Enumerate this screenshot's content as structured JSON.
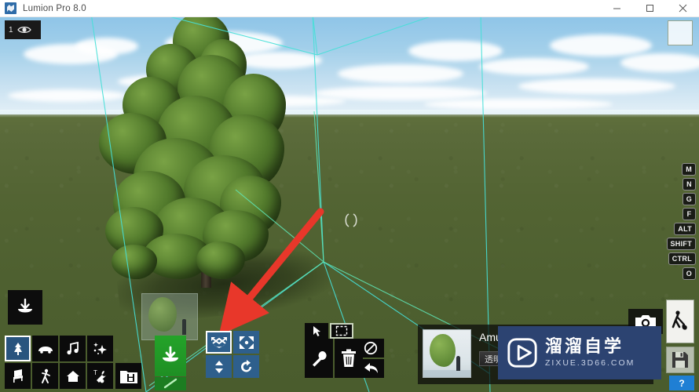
{
  "window": {
    "title": "Lumion Pro 8.0",
    "app_icon": "lumion-logo-icon",
    "minimize_label": "—",
    "maximize_label": "□",
    "close_label": "×"
  },
  "viewport": {
    "badge_number": "1",
    "badge_icon": "eye-icon",
    "corner_box": "viewport-corner-box",
    "selection_cursor": "selection-bracket-cursor",
    "ghost_preview": "ghost-object-preview",
    "bounding_box_color": "#46e0d8",
    "pointer_arrow_color": "#e8372a",
    "sky_color": "#a4d0ea",
    "ground_color": "#536433"
  },
  "key_strip": {
    "keys": [
      "M",
      "N",
      "G",
      "F",
      "ALT",
      "SHIFT",
      "CTRL",
      "O"
    ]
  },
  "place_button": {
    "label": "place-object",
    "icon": "arrow-down-into-bowl-icon"
  },
  "categories": {
    "selected_index": 0,
    "items": [
      {
        "name": "nature",
        "icon": "tree-icon"
      },
      {
        "name": "transport",
        "icon": "car-icon"
      },
      {
        "name": "sound",
        "icon": "music-note-icon"
      },
      {
        "name": "effects",
        "icon": "stars-icon"
      },
      {
        "name": "indoor",
        "icon": "chair-icon"
      },
      {
        "name": "people-and-animals",
        "icon": "person-icon"
      },
      {
        "name": "outdoor",
        "icon": "house-icon"
      },
      {
        "name": "utilities",
        "icon": "text-wrench-icon"
      }
    ],
    "library_button": {
      "name": "library",
      "icon": "save-library-icon"
    }
  },
  "place_green": {
    "name": "place-object-green",
    "icon": "arrow-down-into-bowl-icon"
  },
  "transform_tools": {
    "selected_index": 0,
    "items": [
      {
        "name": "move",
        "icon": "move-arrows-icon"
      },
      {
        "name": "scale",
        "icon": "scale-arrows-icon"
      },
      {
        "name": "height",
        "icon": "up-down-arrows-icon"
      },
      {
        "name": "rotate",
        "icon": "rotate-arrow-icon"
      }
    ]
  },
  "tool_tabs": {
    "items": [
      {
        "name": "select-pointer",
        "icon": "cursor-arrow-icon"
      },
      {
        "name": "marquee-select",
        "icon": "selection-box-icon"
      }
    ]
  },
  "tool_actions": {
    "items": [
      {
        "name": "properties",
        "icon": "wrench-icon"
      },
      {
        "name": "delete",
        "icon": "trash-icon"
      }
    ]
  },
  "side_actions": {
    "items": [
      {
        "name": "cancel",
        "icon": "no-entry-icon"
      },
      {
        "name": "undo",
        "icon": "undo-arrow-icon"
      }
    ]
  },
  "properties": {
    "object_name": "Amur_Cork_R",
    "thumbnail": "object-thumbnail",
    "slider_label": "透明度"
  },
  "watermark": {
    "logo_icon": "play-button-logo-icon",
    "main_text": "溜溜自学",
    "sub_text": "ZIXUE.3D66.COM",
    "bg_color": "#2c4371"
  },
  "right_buttons": {
    "camera": {
      "name": "photo-mode",
      "icon": "camera-icon"
    },
    "build": {
      "name": "build-mode",
      "icon": "person-shovel-icon"
    },
    "save": {
      "name": "save-scene",
      "icon": "floppy-disk-icon"
    },
    "help": {
      "name": "help",
      "label": "?"
    }
  }
}
